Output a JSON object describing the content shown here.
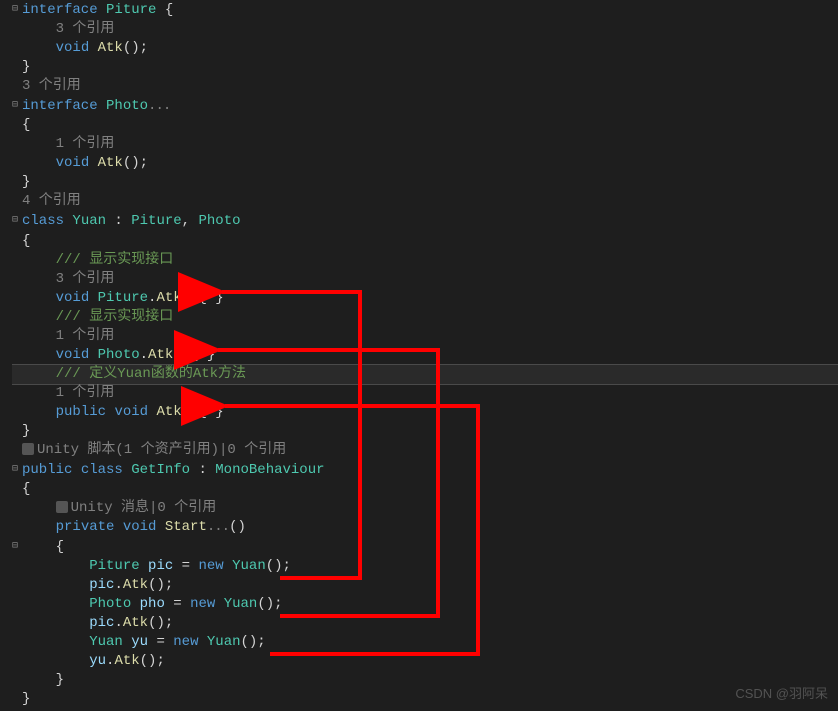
{
  "lines": {
    "l1_kw": "interface",
    "l1_type": "Piture",
    "l1_brace": " {",
    "l2_refs": "3 个引用",
    "l3_ret": "void",
    "l3_method": "Atk",
    "l3_paren": "();",
    "l4_brace": "}",
    "l5_refs": "3 个引用",
    "l6_kw": "interface",
    "l6_type": "Photo",
    "l7_brace": "{",
    "l8_refs": "1 个引用",
    "l9_ret": "void",
    "l9_method": "Atk",
    "l9_paren": "();",
    "l10_brace": "}",
    "l11_refs": "4 个引用",
    "l12_kw": "class",
    "l12_type": "Yuan",
    "l12_sep": " : ",
    "l12_t1": "Piture",
    "l12_comma": ", ",
    "l12_t2": "Photo",
    "l13_brace": "{",
    "l14_comment": "/// 显示实现接口",
    "l15_refs": "3 个引用",
    "l16_ret": "void",
    "l16_t": "Piture",
    "l16_dot": ".",
    "l16_m": "Atk",
    "l16_p": "(){ }",
    "l17_comment": "/// 显示实现接口",
    "l18_refs": "1 个引用",
    "l19_ret": "void",
    "l19_t": "Photo",
    "l19_dot": ".",
    "l19_m": "Atk",
    "l19_p": "(){ }",
    "l20_comment": "/// 定义Yuan函数的Atk方法",
    "l21_refs": "1 个引用",
    "l22_mod": "public",
    "l22_ret": "void",
    "l22_m": "Atk",
    "l22_p": "(){ }",
    "l23_brace": "}",
    "l24_unity": "Unity 脚本(1 个资产引用)|0 个引用",
    "l25_mod": "public",
    "l25_kw": "class",
    "l25_t": "GetInfo",
    "l25_sep": " : ",
    "l25_base": "MonoBehaviour",
    "l26_brace": "{",
    "l27_unity": "Unity 消息|0 个引用",
    "l28_mod": "private",
    "l28_ret": "void",
    "l28_m": "Start",
    "l28_p": "()",
    "l29_brace": "{",
    "l30_t": "Piture",
    "l30_v": "pic",
    "l30_eq": " = ",
    "l30_new": "new",
    "l30_c": "Yuan",
    "l30_p": "();",
    "l31_v": "pic",
    "l31_dot": ".",
    "l31_m": "Atk",
    "l31_p": "();",
    "l32_t": "Photo",
    "l32_v": "pho",
    "l32_eq": " = ",
    "l32_new": "new",
    "l32_c": "Yuan",
    "l32_p": "();",
    "l33_v": "pic",
    "l33_dot": ".",
    "l33_m": "Atk",
    "l33_p": "();",
    "l34_t": "Yuan",
    "l34_v": "yu",
    "l34_eq": " = ",
    "l34_new": "new",
    "l34_c": "Yuan",
    "l34_p": "();",
    "l35_v": "yu",
    "l35_dot": ".",
    "l35_m": "Atk",
    "l35_p": "();",
    "l36_brace": "}",
    "l37_brace": "}"
  },
  "watermark": "CSDN @羽阿呆"
}
